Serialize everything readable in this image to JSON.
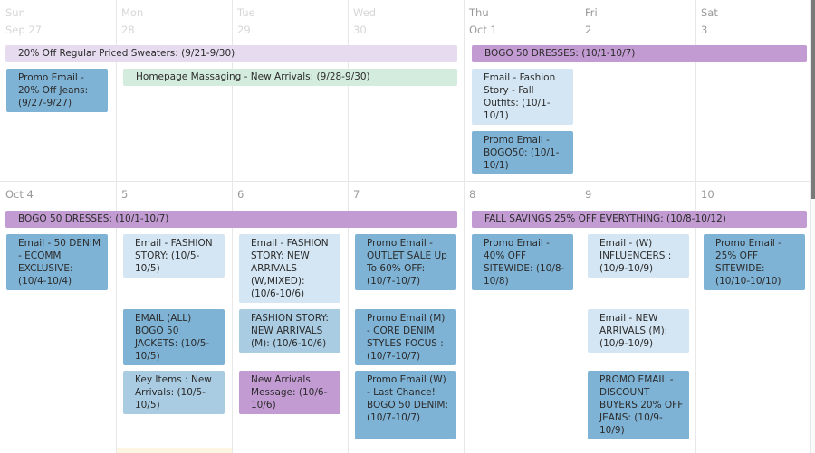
{
  "week1": {
    "days": [
      {
        "weekday": "Sun",
        "date": "Sep 27"
      },
      {
        "weekday": "Mon",
        "date": "28"
      },
      {
        "weekday": "Tue",
        "date": "29"
      },
      {
        "weekday": "Wed",
        "date": "30"
      },
      {
        "weekday": "Thu",
        "date": "Oct 1"
      },
      {
        "weekday": "Fri",
        "date": "2"
      },
      {
        "weekday": "Sat",
        "date": "3"
      }
    ],
    "bars": [
      {
        "label": "20% Off Regular Priced Sweaters: (9/21-9/30)",
        "color": "lavender"
      },
      {
        "label": "BOGO 50 DRESSES: (10/1-10/7)",
        "color": "purple"
      },
      {
        "label": "Homepage Massaging - New Arrivals: (9/28-9/30)",
        "color": "mint"
      }
    ],
    "events": [
      {
        "label": "Promo Email - 20% Off Jeans: (9/27-9/27)",
        "day": "Sun"
      },
      {
        "label": "Email - Fashion Story - Fall Outfits: (10/1-10/1)",
        "day": "Thu"
      },
      {
        "label": "Promo Email - BOGO50: (10/1-10/1)",
        "day": "Thu"
      }
    ]
  },
  "week2": {
    "days": [
      {
        "date": "Oct 4"
      },
      {
        "date": "5"
      },
      {
        "date": "6"
      },
      {
        "date": "7"
      },
      {
        "date": "8"
      },
      {
        "date": "9"
      },
      {
        "date": "10"
      }
    ],
    "bars": [
      {
        "label": "BOGO 50 DRESSES: (10/1-10/7)",
        "color": "purple"
      },
      {
        "label": "FALL SAVINGS 25% OFF EVERYTHING: (10/8-10/12)",
        "color": "purple"
      }
    ],
    "events": [
      {
        "label": "Email - 50 DENIM - ECOMM EXCLUSIVE: (10/4-10/4)",
        "day": "Oct 4"
      },
      {
        "label": "Email - FASHION STORY: (10/5-10/5)",
        "day": "5"
      },
      {
        "label": "EMAIL (ALL) BOGO 50 JACKETS: (10/5-10/5)",
        "day": "5"
      },
      {
        "label": "Key Items : New Arrivals: (10/5-10/5)",
        "day": "5"
      },
      {
        "label": "Email - FASHION STORY: NEW ARRIVALS (W,MIXED): (10/6-10/6)",
        "day": "6"
      },
      {
        "label": "FASHION STORY: NEW ARRIVALS (M): (10/6-10/6)",
        "day": "6"
      },
      {
        "label": "New Arrivals Message: (10/6-10/6)",
        "day": "6"
      },
      {
        "label": "Promo Email - OUTLET SALE Up To 60% OFF: (10/7-10/7)",
        "day": "7"
      },
      {
        "label": "Promo Email (M) - CORE DENIM STYLES FOCUS : (10/7-10/7)",
        "day": "7"
      },
      {
        "label": "Promo Email (W) - Last Chance! BOGO 50 DENIM: (10/7-10/7)",
        "day": "7"
      },
      {
        "label": "Promo Email - 40% OFF SITEWIDE: (10/8-10/8)",
        "day": "8"
      },
      {
        "label": "Email - (W) INFLUENCERS : (10/9-10/9)",
        "day": "9"
      },
      {
        "label": "Email - NEW ARRIVALS (M): (10/9-10/9)",
        "day": "9"
      },
      {
        "label": "PROMO EMAIL - DISCOUNT BUYERS 20% OFF JEANS: (10/9-10/9)",
        "day": "9"
      },
      {
        "label": "Promo Email - 25% OFF SITEWIDE: (10/10-10/10)",
        "day": "10"
      }
    ]
  },
  "colors": {
    "lavender": "#e6dbef",
    "mint": "#d4ecdd",
    "purple": "#c39bd3",
    "blue": "#7fb3d5",
    "light_blue": "#d4e6f3",
    "mid_blue": "#a9cce3"
  }
}
